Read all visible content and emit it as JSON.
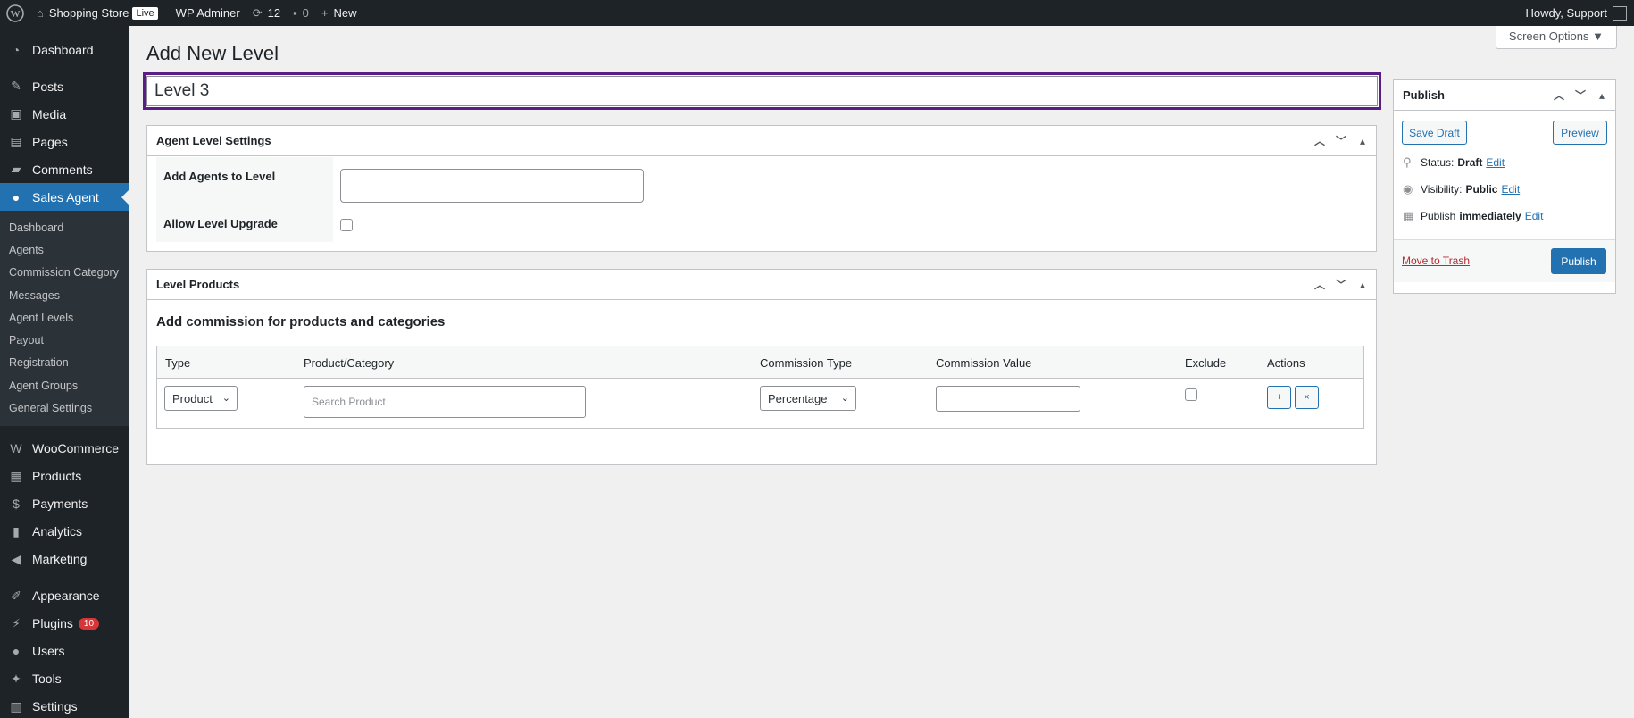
{
  "adminbar": {
    "site_name": "Shopping Store",
    "live_badge": "Live",
    "wp_adminer": "WP Adminer",
    "updates_count": "12",
    "comments_count": "0",
    "new_label": "New",
    "howdy": "Howdy, Support"
  },
  "sidebar": {
    "items_top": [
      {
        "label": "Dashboard",
        "icon": "dashboard-icon"
      },
      {
        "label": "Posts",
        "icon": "pin-icon"
      },
      {
        "label": "Media",
        "icon": "media-icon"
      },
      {
        "label": "Pages",
        "icon": "pages-icon"
      },
      {
        "label": "Comments",
        "icon": "comments-icon"
      },
      {
        "label": "Sales Agent",
        "icon": "user-icon"
      }
    ],
    "submenu": [
      "Dashboard",
      "Agents",
      "Commission Category",
      "Messages",
      "Agent Levels",
      "Payout",
      "Registration",
      "Agent Groups",
      "General Settings"
    ],
    "items_woo": [
      {
        "label": "WooCommerce",
        "icon": "woocommerce-icon"
      },
      {
        "label": "Products",
        "icon": "archive-icon"
      },
      {
        "label": "Payments",
        "icon": "dollar-icon"
      },
      {
        "label": "Analytics",
        "icon": "chart-icon"
      },
      {
        "label": "Marketing",
        "icon": "megaphone-icon"
      }
    ],
    "items_bottom": [
      {
        "label": "Appearance",
        "icon": "brush-icon"
      },
      {
        "label": "Plugins",
        "icon": "plug-icon",
        "badge": "10"
      },
      {
        "label": "Users",
        "icon": "users-icon"
      },
      {
        "label": "Tools",
        "icon": "wrench-icon"
      },
      {
        "label": "Settings",
        "icon": "settings-icon"
      }
    ]
  },
  "main": {
    "screen_options": "Screen Options ▼",
    "page_title": "Add New Level",
    "title_value": "Level 3",
    "agent_settings": {
      "header": "Agent Level Settings",
      "add_agents_label": "Add Agents to Level",
      "allow_upgrade_label": "Allow Level Upgrade"
    },
    "level_products": {
      "header": "Level Products",
      "heading": "Add commission for products and categories",
      "columns": [
        "Type",
        "Product/Category",
        "Commission Type",
        "Commission Value",
        "Exclude",
        "Actions"
      ],
      "row": {
        "type": "Product",
        "search_placeholder": "Search Product",
        "commission_type": "Percentage",
        "add_btn": "+",
        "remove_btn": "×"
      }
    },
    "publish": {
      "header": "Publish",
      "save_draft": "Save Draft",
      "preview": "Preview",
      "status_label": "Status:",
      "status_value": "Draft",
      "visibility_label": "Visibility:",
      "visibility_value": "Public",
      "publish_label": "Publish",
      "publish_value": "immediately",
      "edit": "Edit",
      "move_to_trash": "Move to Trash",
      "publish_btn": "Publish"
    }
  },
  "colors": {
    "accent": "#2271b1",
    "highlight_border": "#5b1e86",
    "admin_dark": "#1d2327"
  }
}
